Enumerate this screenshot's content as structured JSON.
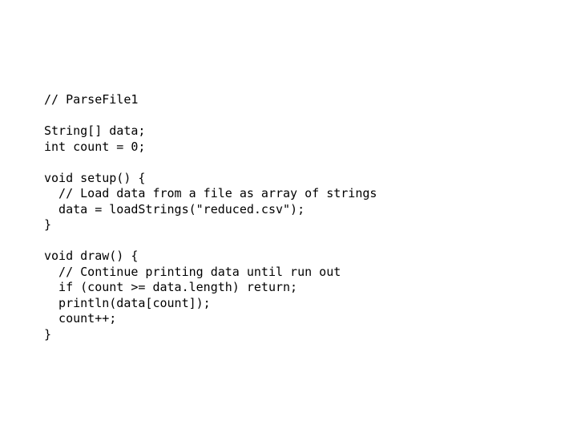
{
  "slide": {
    "background_color": "#ffffff",
    "text_color": "#000000",
    "title_comment": "// ParseFile1"
  },
  "code": {
    "language": "processing",
    "lines": [
      "// ParseFile1",
      "",
      "String[] data;",
      "int count = 0;",
      "",
      "void setup() {",
      "  // Load data from a file as array of strings",
      "  data = loadStrings(\"reduced.csv\");",
      "}",
      "",
      "void draw() {",
      "  // Continue printing data until run out",
      "  if (count >= data.length) return;",
      "  println(data[count]);",
      "  count++;",
      "}"
    ]
  }
}
